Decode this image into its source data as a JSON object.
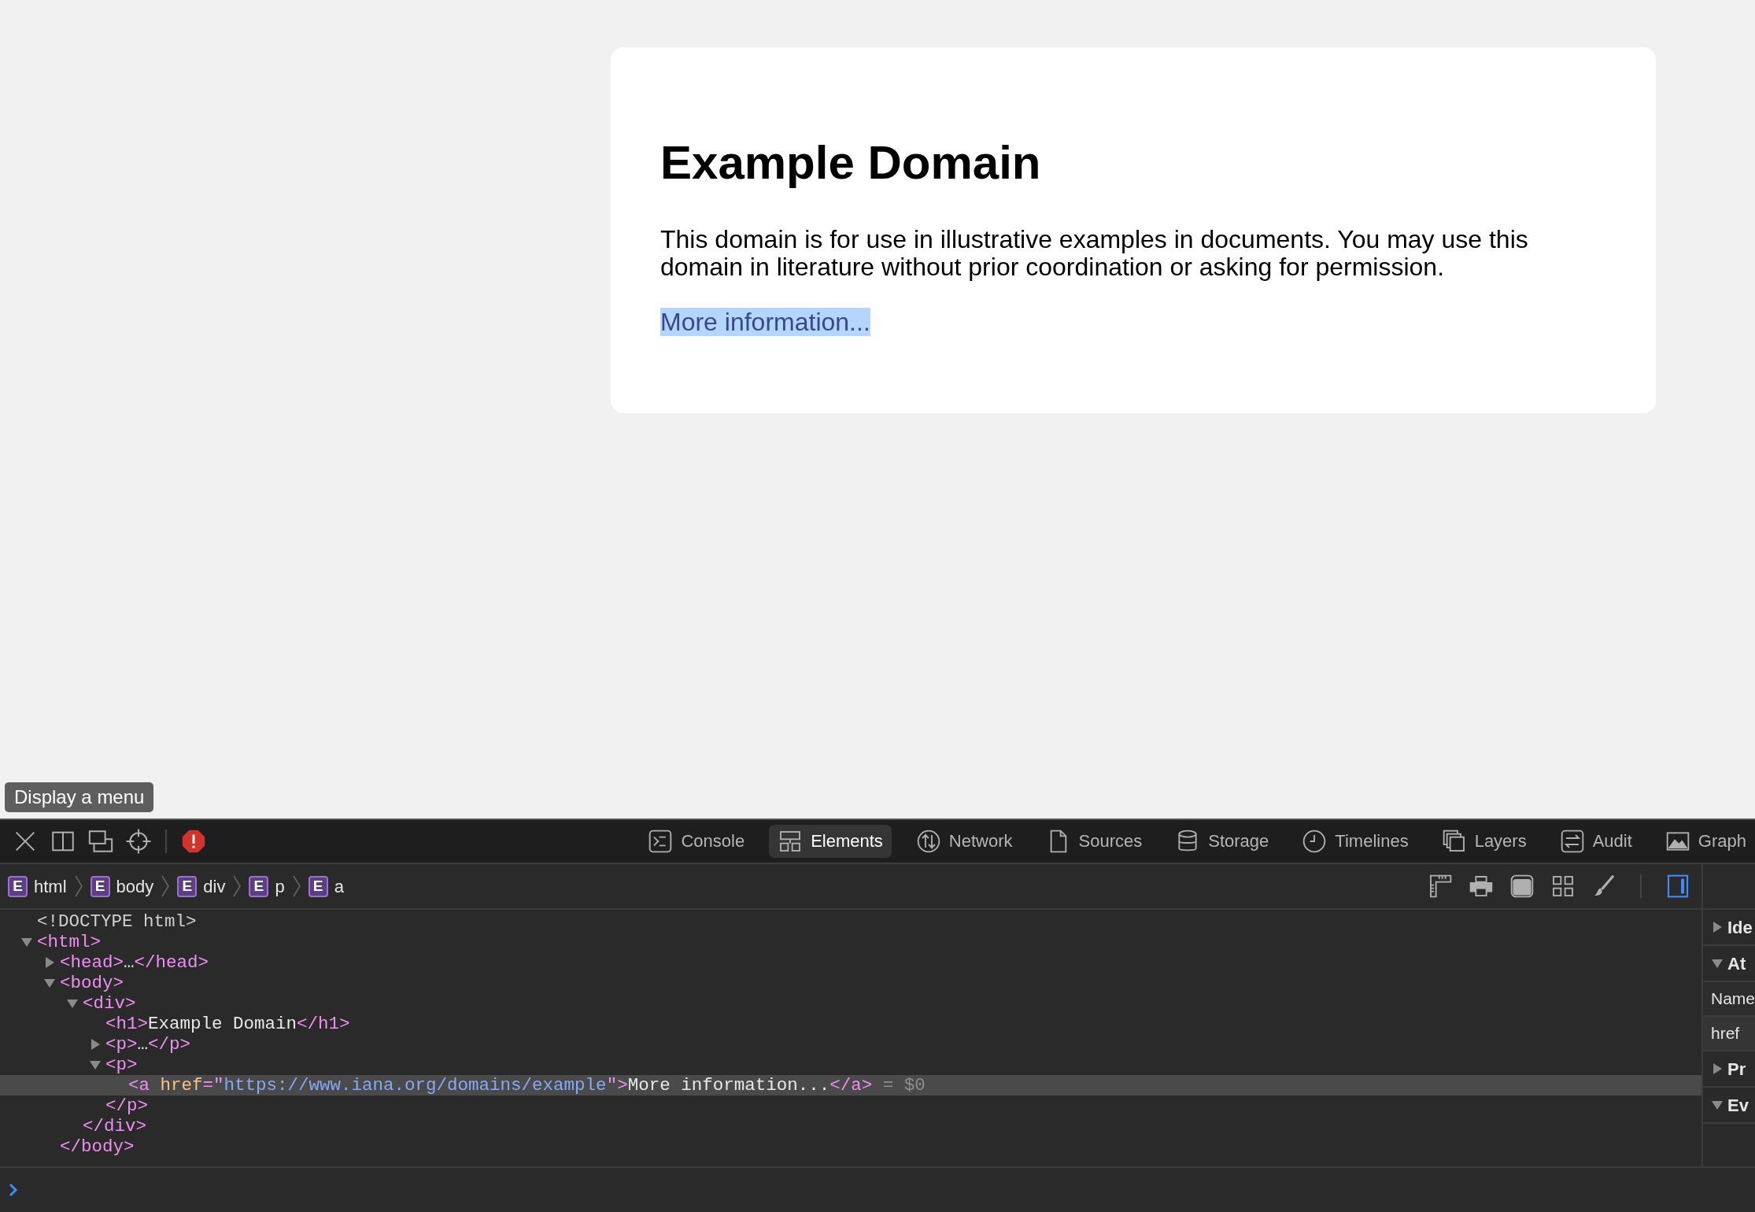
{
  "page": {
    "heading": "Example Domain",
    "paragraph": "This domain is for use in illustrative examples in documents. You may use this domain in literature without prior coordination or asking for permission.",
    "link": {
      "text": "More information...",
      "highlighted": true
    }
  },
  "tooltip": "Display a menu",
  "devtools": {
    "tabs": [
      {
        "kind": "console",
        "label": "Console",
        "selected": false
      },
      {
        "kind": "elements",
        "label": "Elements",
        "selected": true
      },
      {
        "kind": "network",
        "label": "Network",
        "selected": false
      },
      {
        "kind": "sources",
        "label": "Sources",
        "selected": false
      },
      {
        "kind": "storage",
        "label": "Storage",
        "selected": false
      },
      {
        "kind": "timelines",
        "label": "Timelines",
        "selected": false
      },
      {
        "kind": "layers",
        "label": "Layers",
        "selected": false
      },
      {
        "kind": "audit",
        "label": "Audit",
        "selected": false
      },
      {
        "kind": "graphics",
        "label": "Graph",
        "selected": false
      }
    ],
    "breadcrumb": [
      {
        "badge": "E",
        "label": "html"
      },
      {
        "badge": "E",
        "label": "body"
      },
      {
        "badge": "E",
        "label": "div"
      },
      {
        "badge": "E",
        "label": "p"
      },
      {
        "badge": "E",
        "label": "a"
      }
    ],
    "sidebar_toggle": {
      "on": true
    },
    "dom_tree": [
      {
        "selected": false,
        "parts": [
          {
            "kind": "doctype",
            "text": "<!DOCTYPE html>"
          }
        ]
      },
      {
        "selected": false,
        "expanded": true,
        "parts": [
          {
            "kind": "tag",
            "text": "<html>"
          }
        ],
        "children": [
          {
            "selected": false,
            "expanded": false,
            "parts": [
              {
                "kind": "tag",
                "text": "<head>"
              },
              {
                "kind": "text",
                "text": "…"
              },
              {
                "kind": "tag",
                "text": "</head>"
              }
            ]
          },
          {
            "selected": false,
            "expanded": true,
            "parts": [
              {
                "kind": "tag",
                "text": "<body>"
              }
            ],
            "closing": [
              {
                "kind": "tag",
                "text": "</body>"
              }
            ],
            "children": [
              {
                "selected": false,
                "expanded": true,
                "parts": [
                  {
                    "kind": "tag",
                    "text": "<div>"
                  }
                ],
                "closing": [
                  {
                    "kind": "tag",
                    "text": "</div>"
                  }
                ],
                "children": [
                  {
                    "selected": false,
                    "parts": [
                      {
                        "kind": "tag",
                        "text": "<h1>"
                      },
                      {
                        "kind": "text",
                        "text": "Example Domain"
                      },
                      {
                        "kind": "tag",
                        "text": "</h1>"
                      }
                    ]
                  },
                  {
                    "selected": false,
                    "expanded": false,
                    "parts": [
                      {
                        "kind": "tag",
                        "text": "<p>"
                      },
                      {
                        "kind": "text",
                        "text": "…"
                      },
                      {
                        "kind": "tag",
                        "text": "</p>"
                      }
                    ]
                  },
                  {
                    "selected": false,
                    "expanded": true,
                    "parts": [
                      {
                        "kind": "tag",
                        "text": "<p>"
                      }
                    ],
                    "closing": [
                      {
                        "kind": "tag",
                        "text": "</p>"
                      }
                    ],
                    "children": [
                      {
                        "selected": true,
                        "parts": [
                          {
                            "kind": "tag",
                            "text": "<a "
                          },
                          {
                            "kind": "attr",
                            "text": "href"
                          },
                          {
                            "kind": "tag",
                            "text": "=\""
                          },
                          {
                            "kind": "value",
                            "text": "https://www.iana.org/domains/example"
                          },
                          {
                            "kind": "tag",
                            "text": "\">"
                          },
                          {
                            "kind": "text",
                            "text": "More information..."
                          },
                          {
                            "kind": "tag",
                            "text": "</a>"
                          },
                          {
                            "kind": "hint",
                            "text": " = $0"
                          }
                        ]
                      }
                    ]
                  }
                ]
              }
            ]
          }
        ]
      }
    ],
    "sidebar": [
      {
        "title": "Ide",
        "expanded": false
      },
      {
        "title": "At",
        "expanded": true,
        "table": {
          "header": "Name",
          "rows": [
            "href"
          ]
        }
      },
      {
        "title": "Pr",
        "expanded": false
      },
      {
        "title": "Ev",
        "expanded": true
      }
    ]
  }
}
